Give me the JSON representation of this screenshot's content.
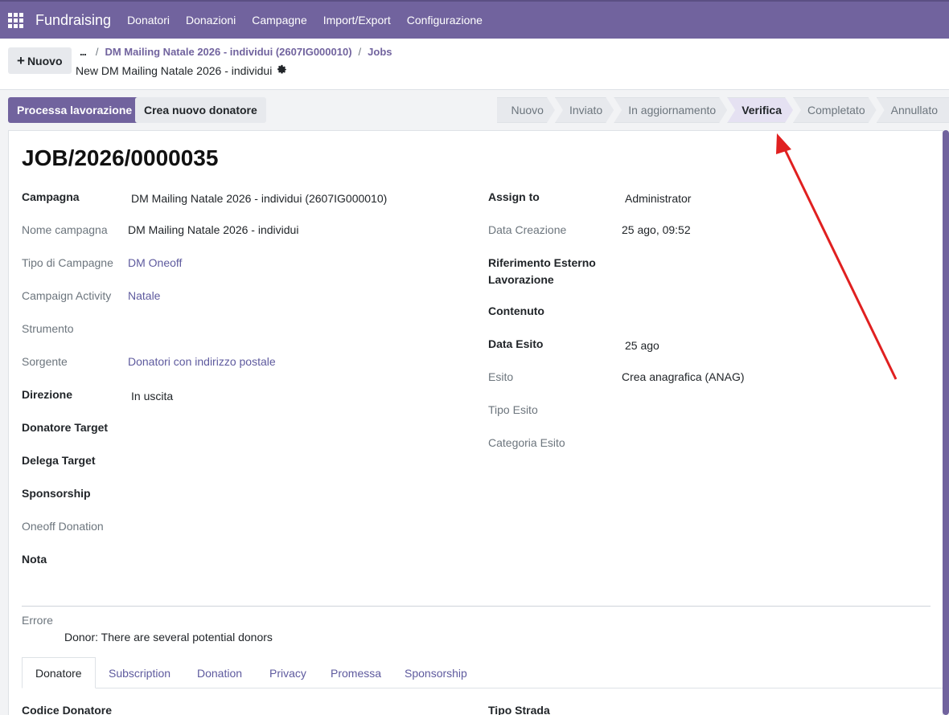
{
  "navbar": {
    "brand": "Fundraising",
    "items": [
      "Donatori",
      "Donazioni",
      "Campagne",
      "Import/Export",
      "Configurazione"
    ]
  },
  "control": {
    "new_label": "Nuovo",
    "dots": "...",
    "breadcrumb": [
      "DM Mailing Natale 2026 - individui (2607IG000010)",
      "Jobs"
    ],
    "record_name": "New DM Mailing Natale 2026 - individui"
  },
  "actions": {
    "process": "Processa lavorazione",
    "create_donor": "Crea nuovo donatore"
  },
  "statusbar": {
    "stages": [
      "Nuovo",
      "Inviato",
      "In aggiornamento",
      "Verifica",
      "Completato",
      "Annullato"
    ],
    "active": "Verifica"
  },
  "form": {
    "title": "JOB/2026/0000035",
    "left": {
      "campagna_label": "Campagna",
      "campagna_value": "DM Mailing Natale 2026 -  individui (2607IG000010)",
      "nome_label": "Nome campagna",
      "nome_value": "DM Mailing Natale 2026 - individui",
      "tipo_label": "Tipo di Campagne",
      "tipo_value": "DM Oneoff",
      "activity_label": "Campaign Activity",
      "activity_value": "Natale",
      "strumento_label": "Strumento",
      "sorgente_label": "Sorgente",
      "sorgente_value": "Donatori con indirizzo postale",
      "direzione_label": "Direzione",
      "direzione_value": "In uscita",
      "donatore_label": "Donatore Target",
      "delega_label": "Delega Target",
      "sponsorship_label": "Sponsorship",
      "oneoff_label": "Oneoff Donation",
      "nota_label": "Nota"
    },
    "right": {
      "assign_label": "Assign to",
      "assign_value": "Administrator",
      "data_creazione_label": "Data Creazione",
      "data_creazione_value": "25 ago, 09:52",
      "rif_label_1": "Riferimento Esterno",
      "rif_label_2": "Lavorazione",
      "contenuto_label": "Contenuto",
      "data_esito_label": "Data Esito",
      "data_esito_value": "25 ago",
      "esito_label": "Esito",
      "esito_value": "Crea anagrafica (ANAG)",
      "tipo_esito_label": "Tipo Esito",
      "categoria_esito_label": "Categoria Esito"
    },
    "errore_label": "Errore",
    "errore_value": "Donor: There are several potential donors",
    "tabs": [
      "Donatore",
      "Subscription",
      "Donation",
      "Privacy",
      "Promessa",
      "Sponsorship"
    ],
    "bottom_left_label": "Codice Donatore",
    "bottom_right_label": "Tipo Strada"
  },
  "colors": {
    "brand": "#71639e",
    "arrow": "#e02020"
  }
}
